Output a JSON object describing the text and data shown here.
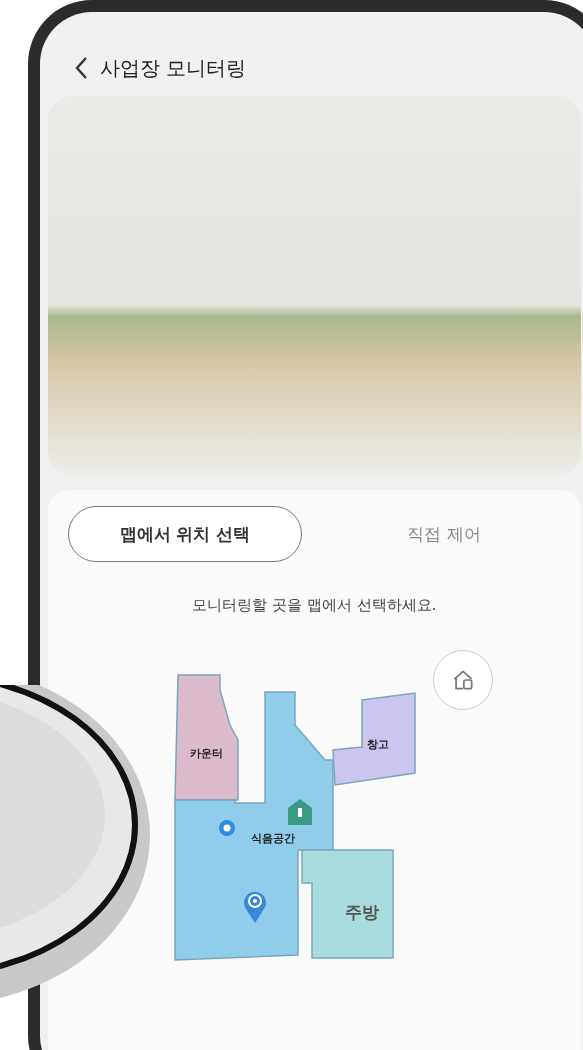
{
  "header": {
    "title": "사업장 모니터링"
  },
  "tabs": [
    {
      "label": "맵에서 위치 선택",
      "selected": true
    },
    {
      "label": "직접 제어",
      "selected": false
    }
  ],
  "instruction": "모니터링할 곳을 맵에서 선택하세요.",
  "map": {
    "rooms": [
      {
        "name": "카운터",
        "color": "#dcbccc"
      },
      {
        "name": "식음공간",
        "color": "#8fcdea"
      },
      {
        "name": "창고",
        "color": "#cbc5ef"
      },
      {
        "name": "주방",
        "color": "#a9dcdc"
      }
    ]
  }
}
